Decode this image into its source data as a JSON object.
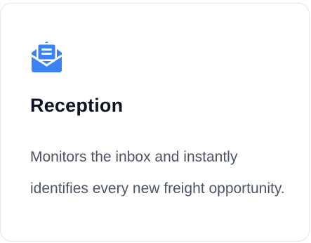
{
  "card": {
    "icon": "open-envelope-letter-icon",
    "accent_color": "#3b82f6",
    "title": "Reception",
    "description": "Monitors the inbox and instantly identifies every new freight opportunity."
  }
}
